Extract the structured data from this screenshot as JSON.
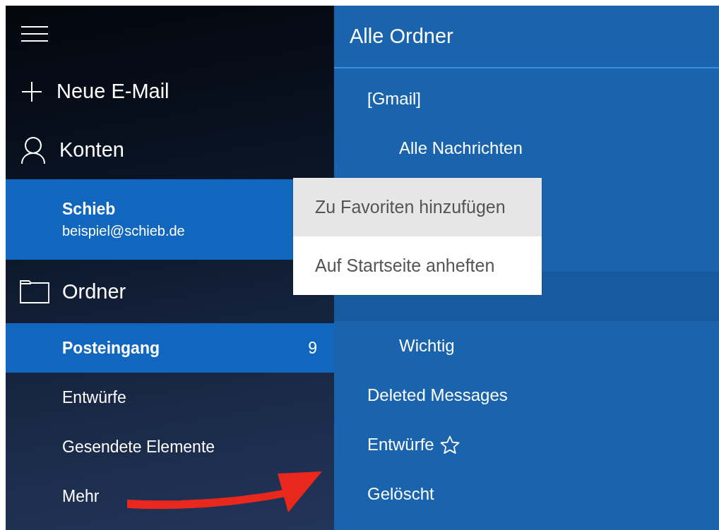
{
  "sidebar": {
    "actions": [
      {
        "kind": "new",
        "label": "Neue E-Mail"
      },
      {
        "kind": "accounts",
        "label": "Konten"
      }
    ],
    "account": {
      "name": "Schieb",
      "email": "beispiel@schieb.de",
      "selected": true
    },
    "folders_header": "Ordner",
    "folders": [
      {
        "label": "Posteingang",
        "count": "9",
        "selected": true
      },
      {
        "label": "Entwürfe",
        "selected": false
      },
      {
        "label": "Gesendete Elemente",
        "selected": false
      },
      {
        "label": "Mehr",
        "selected": false
      }
    ]
  },
  "all_folders": {
    "title": "Alle Ordner",
    "tree": [
      {
        "kind": "folder",
        "label": "[Gmail]",
        "selected": false,
        "favorite": false,
        "children": [
          {
            "kind": "folder",
            "label": "Alle Nachrichten",
            "selected": false,
            "favorite": false
          },
          {
            "kind": "covered"
          },
          {
            "kind": "covered"
          },
          {
            "kind": "folder",
            "selected": true,
            "favorite": false
          },
          {
            "kind": "folder",
            "label": "Wichtig",
            "selected": false,
            "favorite": false
          }
        ]
      },
      {
        "kind": "folder",
        "label": "Deleted Messages",
        "selected": false,
        "favorite": false
      },
      {
        "kind": "folder",
        "label": "Entwürfe",
        "selected": false,
        "favorite": true
      },
      {
        "kind": "folder",
        "label": "Gelöscht",
        "selected": false,
        "favorite": false
      }
    ]
  },
  "context_menu": {
    "items": [
      {
        "label": "Zu Favoriten hinzufügen",
        "selected": true
      },
      {
        "label": "Auf Startseite anheften",
        "selected": false
      }
    ]
  }
}
